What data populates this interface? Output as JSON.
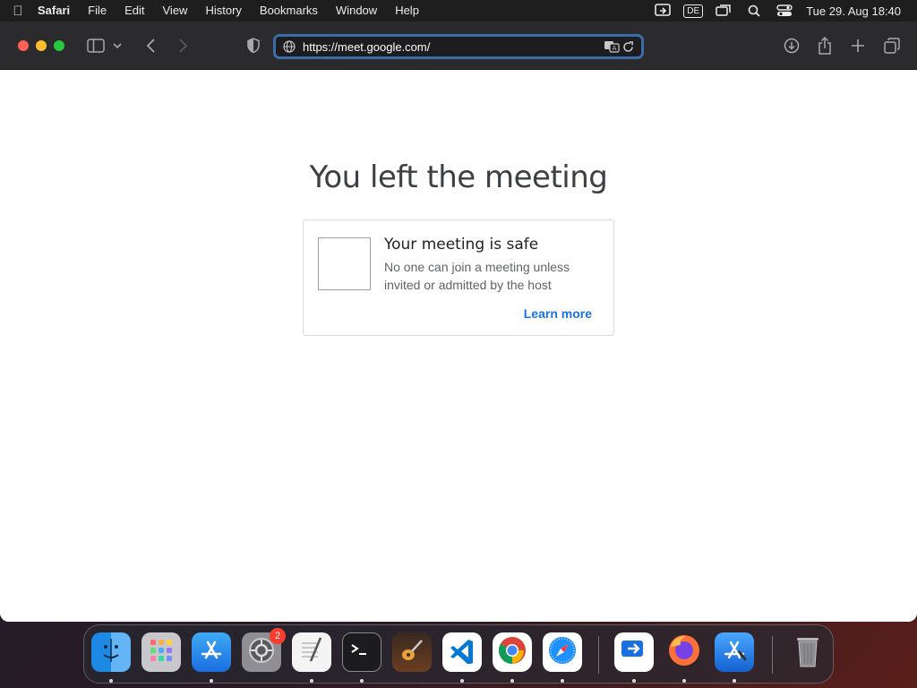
{
  "menubar": {
    "app_name": "Safari",
    "items": [
      "File",
      "Edit",
      "View",
      "History",
      "Bookmarks",
      "Window",
      "Help"
    ],
    "input_source": "DE",
    "clock": "Tue 29. Aug  18:40"
  },
  "browser": {
    "url": "https://meet.google.com/",
    "colors": {
      "toolbar": "#2b2b2d",
      "url_focus_ring": "#3b6ea8"
    }
  },
  "page": {
    "title": "You left the meeting",
    "card": {
      "title": "Your meeting is safe",
      "description": "No one can join a meeting unless invited or admitted by the host",
      "link": "Learn more"
    },
    "colors": {
      "link": "#1a73e8",
      "title": "#3c4043"
    }
  },
  "dock": {
    "apps": [
      {
        "name": "Finder",
        "icon": "finder-icon"
      },
      {
        "name": "Launchpad",
        "icon": "launchpad-icon"
      },
      {
        "name": "App Store",
        "icon": "app-store-icon"
      },
      {
        "name": "System Settings",
        "icon": "settings-icon",
        "badge": "2"
      },
      {
        "name": "TextEdit",
        "icon": "textedit-icon"
      },
      {
        "name": "Terminal",
        "icon": "terminal-icon"
      },
      {
        "name": "GarageBand",
        "icon": "guitar-icon"
      },
      {
        "name": "Visual Studio Code",
        "icon": "vscode-icon"
      },
      {
        "name": "Google Chrome",
        "icon": "chrome-icon"
      },
      {
        "name": "Safari",
        "icon": "safari-icon"
      },
      {
        "name": "Screen Sharing",
        "icon": "screen-sharing-icon"
      },
      {
        "name": "Firefox",
        "icon": "firefox-icon"
      },
      {
        "name": "Xcode",
        "icon": "xcode-icon"
      },
      {
        "name": "Trash",
        "icon": "trash-icon"
      }
    ]
  }
}
